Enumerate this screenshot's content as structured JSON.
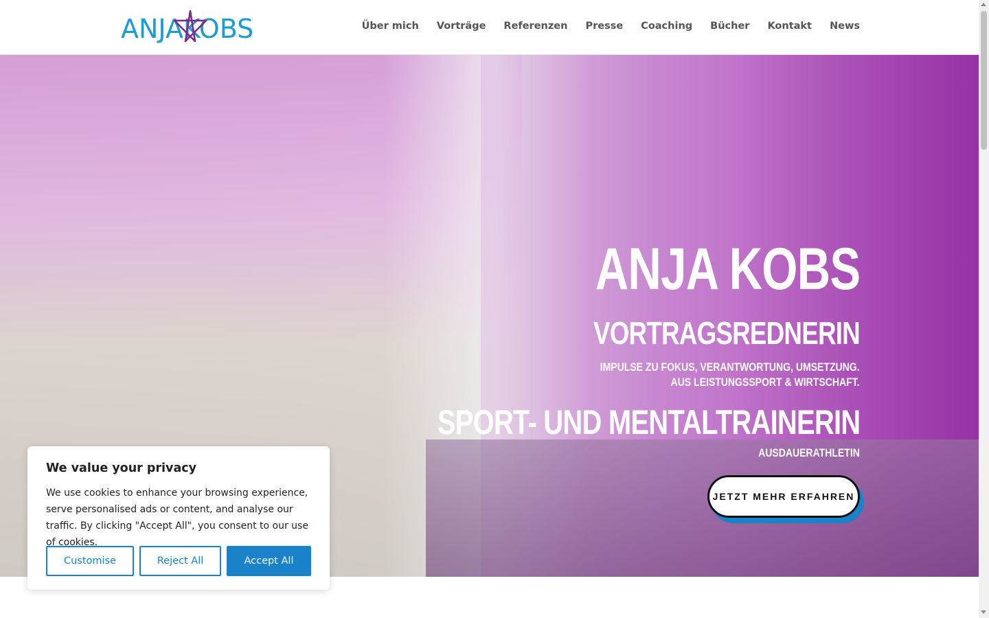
{
  "header": {
    "logo_text": "ANJAKOBS",
    "nav": [
      "Über mich",
      "Vorträge",
      "Referenzen",
      "Presse",
      "Coaching",
      "Bücher",
      "Kontakt",
      "News"
    ]
  },
  "hero": {
    "name": "ANJA KOBS",
    "subtitle1": "VORTRAGSREDNERIN",
    "tagline_line1": "IMPULSE ZU FOKUS, VERANTWORTUNG, UMSETZUNG.",
    "tagline_line2": "AUS LEISTUNGSSPORT & WIRTSCHAFT.",
    "subtitle2": "SPORT- UND MENTALTRAINERIN",
    "tagline3": "AUSDAUERATHLETIN",
    "cta_label": "JETZT MEHR ERFAHREN"
  },
  "cookie": {
    "title": "We value your privacy",
    "body": "We use cookies to enhance your browsing experience, serve personalised ads or content, and analyse our traffic. By clicking \"Accept All\", you consent to our use of cookies.",
    "customise_label": "Customise",
    "reject_label": "Reject All",
    "accept_label": "Accept All"
  },
  "colors": {
    "brand_blue": "#1a82c9",
    "logo_blue": "#1d9bd6",
    "logo_star": "#7b2b86",
    "hero_purple": "#9a3aa8"
  }
}
